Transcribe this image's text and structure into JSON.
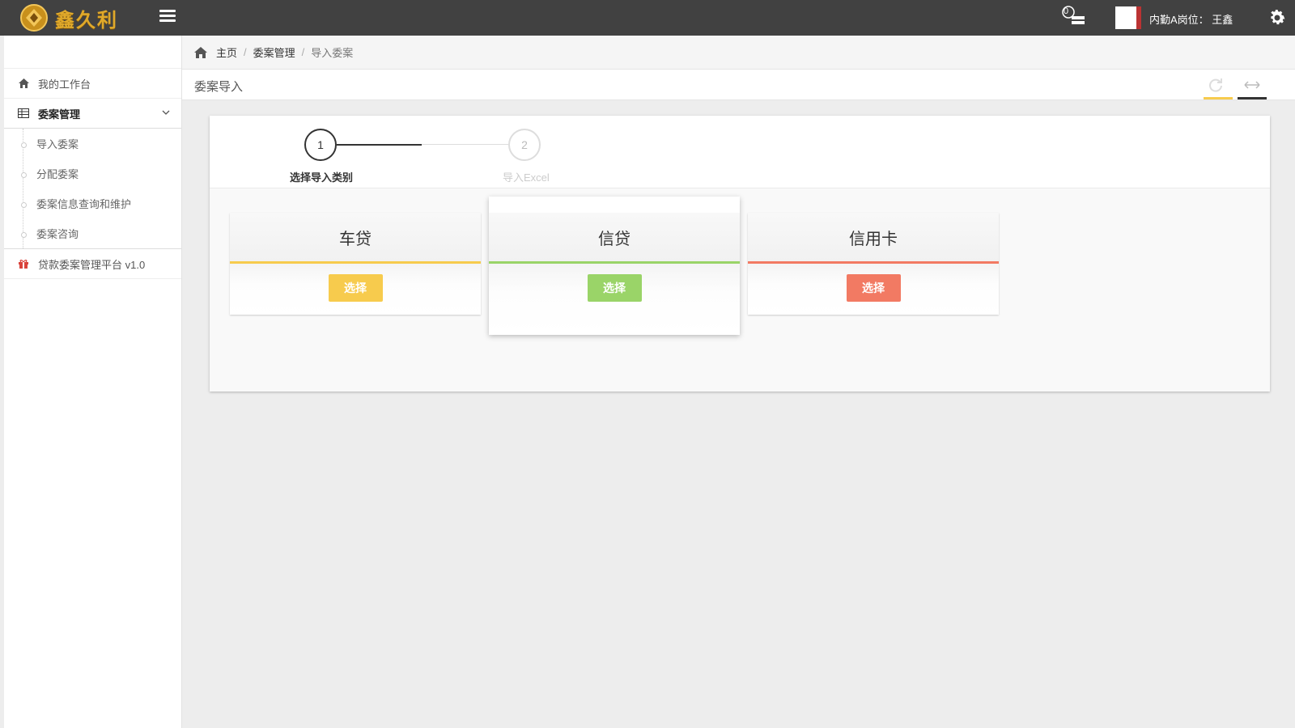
{
  "app": {
    "logo_text": "鑫久利",
    "message_count": "0",
    "user_label": "内勤A岗位： 王鑫"
  },
  "sidebar": {
    "items": [
      {
        "label": "我的工作台",
        "icon": "home-icon"
      },
      {
        "label": "委案管理",
        "icon": "table-icon",
        "expanded": true,
        "children": [
          "导入委案",
          "分配委案",
          "委案信息查询和维护",
          "委案咨询"
        ]
      },
      {
        "label": "贷款委案管理平台 v1.0",
        "icon": "gift-icon"
      }
    ]
  },
  "breadcrumb": [
    "主页",
    "委案管理",
    "导入委案"
  ],
  "page": {
    "title": "委案导入"
  },
  "steps": [
    {
      "number": "1",
      "label": "选择导入类别",
      "state": "active"
    },
    {
      "number": "2",
      "label": "导入Excel",
      "state": "pending"
    }
  ],
  "categories": [
    {
      "title": "车贷",
      "button": "选择",
      "color": "#f7cb4d"
    },
    {
      "title": "信贷",
      "button": "选择",
      "color": "#9ad468"
    },
    {
      "title": "信用卡",
      "button": "选择",
      "color": "#f27a63"
    }
  ],
  "colors": {
    "topbar": "#414141",
    "accent_yellow": "#f7cb4d",
    "accent_green": "#9ad468",
    "accent_red": "#f27a63",
    "logo_gold": "#e0a92a"
  }
}
